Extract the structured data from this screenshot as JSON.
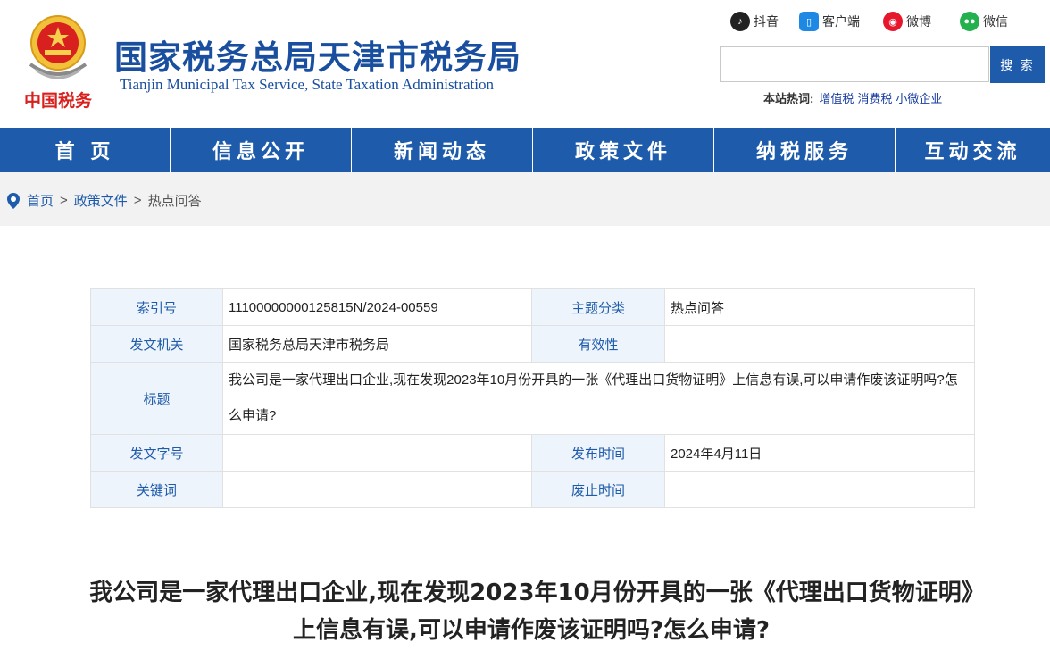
{
  "header": {
    "emblem_text": "中国税务",
    "site_name_cn": "国家税务总局天津市税务局",
    "site_name_en": "Tianjin Municipal Tax Service, State Taxation Administration",
    "social": [
      {
        "label": "抖音",
        "icon": "douyin-icon",
        "color": "#222222"
      },
      {
        "label": "客户端",
        "icon": "mobile-app-icon",
        "color": "#1e88e5"
      },
      {
        "label": "微博",
        "icon": "weibo-icon",
        "color": "#e6162d"
      },
      {
        "label": "微信",
        "icon": "wechat-icon",
        "color": "#22b14c"
      }
    ],
    "search": {
      "placeholder": "",
      "button": "搜 索"
    },
    "hot_label": "本站热词:",
    "hot_words": [
      "增值税",
      "消费税",
      "小微企业"
    ]
  },
  "nav": [
    "首 页",
    "信息公开",
    "新闻动态",
    "政策文件",
    "纳税服务",
    "互动交流"
  ],
  "breadcrumb": {
    "items": [
      "首页",
      "政策文件"
    ],
    "current": "热点问答",
    "separator": ">"
  },
  "info": {
    "index_label": "索引号",
    "index_value": "11100000000125815N/2024-00559",
    "category_label": "主题分类",
    "category_value": "热点问答",
    "issuer_label": "发文机关",
    "issuer_value": "国家税务总局天津市税务局",
    "validity_label": "有效性",
    "validity_value": "",
    "title_label": "标题",
    "title_value": "我公司是一家代理出口企业,现在发现2023年10月份开具的一张《代理出口货物证明》上信息有误,可以申请作废该证明吗?怎么申请?",
    "docno_label": "发文字号",
    "docno_value": "",
    "pubdate_label": "发布时间",
    "pubdate_value": "2024年4月11日",
    "keywords_label": "关键词",
    "keywords_value": "",
    "expire_label": "废止时间",
    "expire_value": ""
  },
  "article": {
    "title": "我公司是一家代理出口企业,现在发现2023年10月份开具的一张《代理出口货物证明》上信息有误,可以申请作废该证明吗?怎么申请?"
  },
  "colors": {
    "brand_blue": "#1e5bab",
    "label_bg": "#eef4fb",
    "crumb_bg": "#f2f2f2"
  }
}
